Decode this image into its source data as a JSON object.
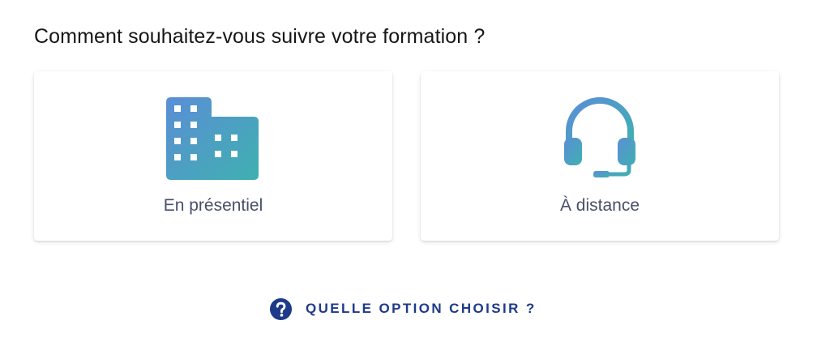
{
  "question": "Comment souhaitez-vous suivre votre formation ?",
  "options": [
    {
      "label": "En présentiel",
      "icon": "building-icon"
    },
    {
      "label": "À distance",
      "icon": "headset-icon"
    }
  ],
  "help": {
    "label": "QUELLE OPTION CHOISIR ?",
    "icon": "question-circle-icon"
  },
  "colors": {
    "icon_gradient_start": "#5b8ed6",
    "icon_gradient_end": "#3fb0b0",
    "label_text": "#4a4f6a",
    "help_accent": "#1e3a8a",
    "question_text": "#161616"
  }
}
